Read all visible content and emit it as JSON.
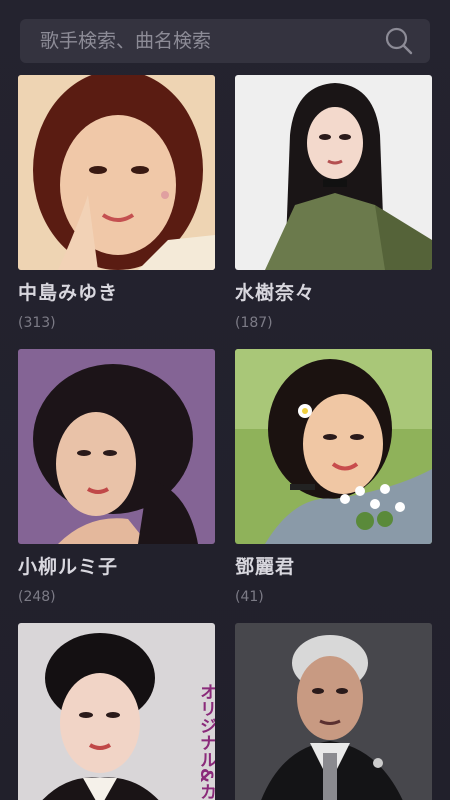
{
  "search": {
    "placeholder": "歌手検索、曲名検索"
  },
  "artists": [
    {
      "name": "中島みゆき",
      "count": "(313)"
    },
    {
      "name": "水樹奈々",
      "count": "(187)"
    },
    {
      "name": "小柳ルミ子",
      "count": "(248)"
    },
    {
      "name": "鄧麗君",
      "count": "(41)"
    },
    {
      "name": "",
      "count": "",
      "photo_text": "オリジナル&カ"
    },
    {
      "name": "",
      "count": ""
    }
  ],
  "colors": {
    "background": "#24232f",
    "search_bg": "#34333f",
    "text_primary": "#d8d7de",
    "text_secondary": "#7c7b86"
  }
}
